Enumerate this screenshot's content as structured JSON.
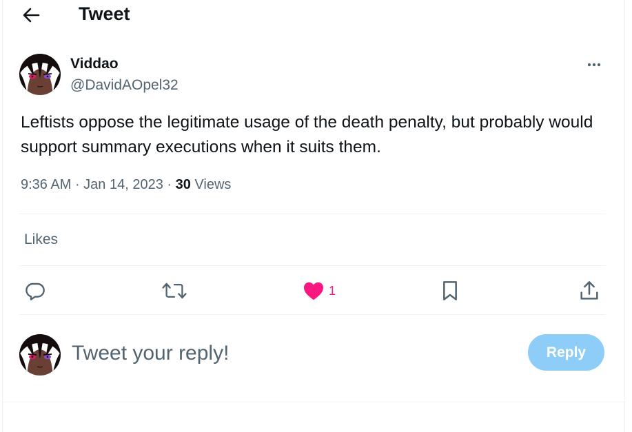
{
  "header": {
    "title": "Tweet",
    "back_icon": "arrow-left-icon"
  },
  "tweet": {
    "author_name": "Viddao",
    "author_handle": "@DavidAOpel32",
    "text": "Leftists oppose the legitimate usage of the death penalty, but probably would support summary executions when it suits them.",
    "time": "9:36 AM",
    "separator": " · ",
    "date": "Jan 14, 2023",
    "views_count": "30",
    "views_label": "Views"
  },
  "engagement": {
    "likes_link": "Likes"
  },
  "actions": {
    "reply_icon": "comment-icon",
    "retweet_icon": "retweet-icon",
    "like_icon": "heart-icon",
    "like_count": "1",
    "bookmark_icon": "bookmark-icon",
    "share_icon": "share-icon"
  },
  "composer": {
    "placeholder": "Tweet your reply!",
    "button_label": "Reply"
  },
  "colors": {
    "text_primary": "#0f1419",
    "text_secondary": "#536471",
    "like_pink": "#f91880",
    "reply_button_disabled": "#8ecdf7",
    "divider": "#eff3f4"
  }
}
